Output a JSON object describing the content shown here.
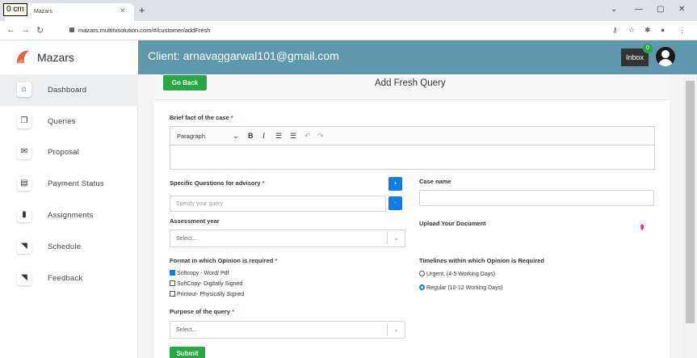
{
  "ruler": {
    "label": "0 cm"
  },
  "browser": {
    "tab_title": "Mazars",
    "tab_close": "×",
    "new_tab": "+",
    "url": "mazars.multitvsolution.com/#/customer/addFresh",
    "win_min": "—",
    "win_restore": "▢",
    "win_close": "✕"
  },
  "brand": {
    "name": "Mazars",
    "logo_color": "#e8604c"
  },
  "header": {
    "client_text": "Client: arnavaggarwal101@gmail.com",
    "inbox_label": "Inbox",
    "inbox_count": "0",
    "color": "#5f97ad"
  },
  "sidebar": {
    "items": [
      {
        "label": "Dashboard",
        "icon": "home-icon",
        "glyph": "⌂",
        "active": true
      },
      {
        "label": "Queries",
        "icon": "copy-icon",
        "glyph": "❐"
      },
      {
        "label": "Proposal",
        "icon": "envelope-icon",
        "glyph": "✉"
      },
      {
        "label": "Payment Status",
        "icon": "file-icon",
        "glyph": "▤"
      },
      {
        "label": "Assignments",
        "icon": "file-solid-icon",
        "glyph": "▮"
      },
      {
        "label": "Schedule",
        "icon": "rss-icon",
        "glyph": "◥"
      },
      {
        "label": "Feedback",
        "icon": "rss-icon",
        "glyph": "◥"
      }
    ]
  },
  "form": {
    "go_back_label": "Go Back",
    "title": "Add Fresh Query",
    "brief_label": "Brief fact of the case",
    "required_mark": "*",
    "editor": {
      "block_style": "Paragraph",
      "bold": "B",
      "italic": "I",
      "undo": "↶",
      "redo": "↷"
    },
    "questions_label": "Specific Questions for advisory",
    "questions_placeholder": "Specify your query",
    "add_button": "+",
    "remove_button": "-",
    "case_name_label": "Case name",
    "case_name_value": "",
    "assessment_label": "Assessment year",
    "assessment_placeholder": "Select...",
    "upload_label": "Upload Your Document",
    "format_label": "Format in which Opinion is required",
    "formats": [
      {
        "label": "Softcopy - Word/ Pdf",
        "checked": true
      },
      {
        "label": "SoftCopy- Digitally Signed",
        "checked": false
      },
      {
        "label": "Printout- Physically Signed",
        "checked": false
      }
    ],
    "timelines_label": "Timelines within which Opinion is Required",
    "timelines": [
      {
        "label": "Urgent, (4-5 Working Days)",
        "selected": false
      },
      {
        "label": "Regular (10-12 Working Days)",
        "selected": true
      }
    ],
    "purpose_label": "Purpose of the query",
    "purpose_placeholder": "Select...",
    "submit_label": "Submit"
  },
  "colors": {
    "accent_green": "#28a745",
    "accent_blue": "#0d7ee8",
    "required_red": "#dc3545"
  }
}
